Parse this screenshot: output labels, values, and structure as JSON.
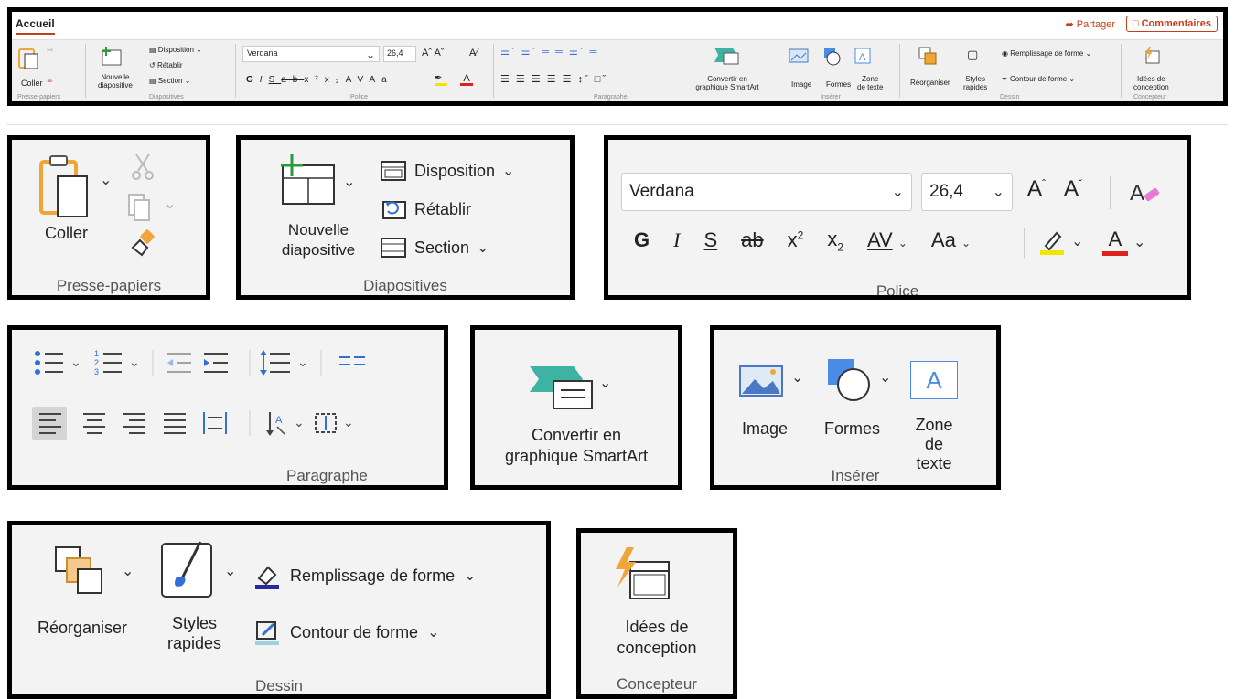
{
  "ribbon": {
    "tab_accueil": "Accueil",
    "share": "Partager",
    "comments": "Commentaires",
    "clipboard": {
      "paste": "Coller",
      "label": "Presse-papiers"
    },
    "slides": {
      "new_slide_line1": "Nouvelle",
      "new_slide_line2": "diapositive",
      "layout": "Disposition",
      "reset": "Rétablir",
      "section": "Section",
      "label": "Diapositives"
    },
    "font": {
      "name": "Verdana",
      "size": "26,4",
      "label": "Police",
      "bold": "G",
      "italic": "I",
      "underline": "S",
      "strike": "ab",
      "superscript": "x²",
      "subscript": "x₂",
      "spacing": "AV",
      "case": "Aa",
      "color_letter": "A"
    },
    "paragraph": {
      "label": "Paragraphe"
    },
    "smartart": {
      "line1": "Convertir en",
      "line2": "graphique SmartArt"
    },
    "insert": {
      "image": "Image",
      "shapes": "Formes",
      "textbox_line1": "Zone",
      "textbox_line2": "de texte",
      "label": "Insérer"
    },
    "drawing": {
      "arrange": "Réorganiser",
      "styles_line1": "Styles",
      "styles_line2": "rapides",
      "fill": "Remplissage de forme",
      "outline": "Contour de forme",
      "label": "Dessin"
    },
    "designer": {
      "line1": "Idées de",
      "line2": "conception",
      "label": "Concepteur"
    }
  },
  "clipboard": {
    "paste": "Coller",
    "label": "Presse-papiers"
  },
  "slides": {
    "new_slide_line1": "Nouvelle",
    "new_slide_line2": "diapositive",
    "layout": "Disposition",
    "reset": "Rétablir",
    "section": "Section",
    "label": "Diapositives"
  },
  "font": {
    "name": "Verdana",
    "size": "26,4",
    "bold": "G",
    "italic": "I",
    "underline": "S",
    "strike": "ab",
    "superscript": "x",
    "sup_mark": "2",
    "subscript": "x",
    "sub_mark": "2",
    "spacing": "AV",
    "case": "Aa",
    "color_letter": "A",
    "grow": "A",
    "shrink": "A",
    "label": "Police"
  },
  "paragraph": {
    "label": "Paragraphe"
  },
  "smartart": {
    "line1": "Convertir en",
    "line2": "graphique SmartArt"
  },
  "insert": {
    "image": "Image",
    "shapes": "Formes",
    "textbox_line1": "Zone",
    "textbox_line2": "de texte",
    "textbox_glyph": "A",
    "label": "Insérer"
  },
  "drawing": {
    "arrange": "Réorganiser",
    "styles_line1": "Styles",
    "styles_line2": "rapides",
    "fill": "Remplissage de forme",
    "outline": "Contour de forme",
    "label": "Dessin"
  },
  "designer": {
    "line1": "Idées de",
    "line2": "conception",
    "label": "Concepteur"
  },
  "colors": {
    "accent": "#c43e1c",
    "highlight": "#f2e600",
    "font_color": "#e02020",
    "orange": "#f0a53a",
    "blue": "#2f6fd6"
  }
}
